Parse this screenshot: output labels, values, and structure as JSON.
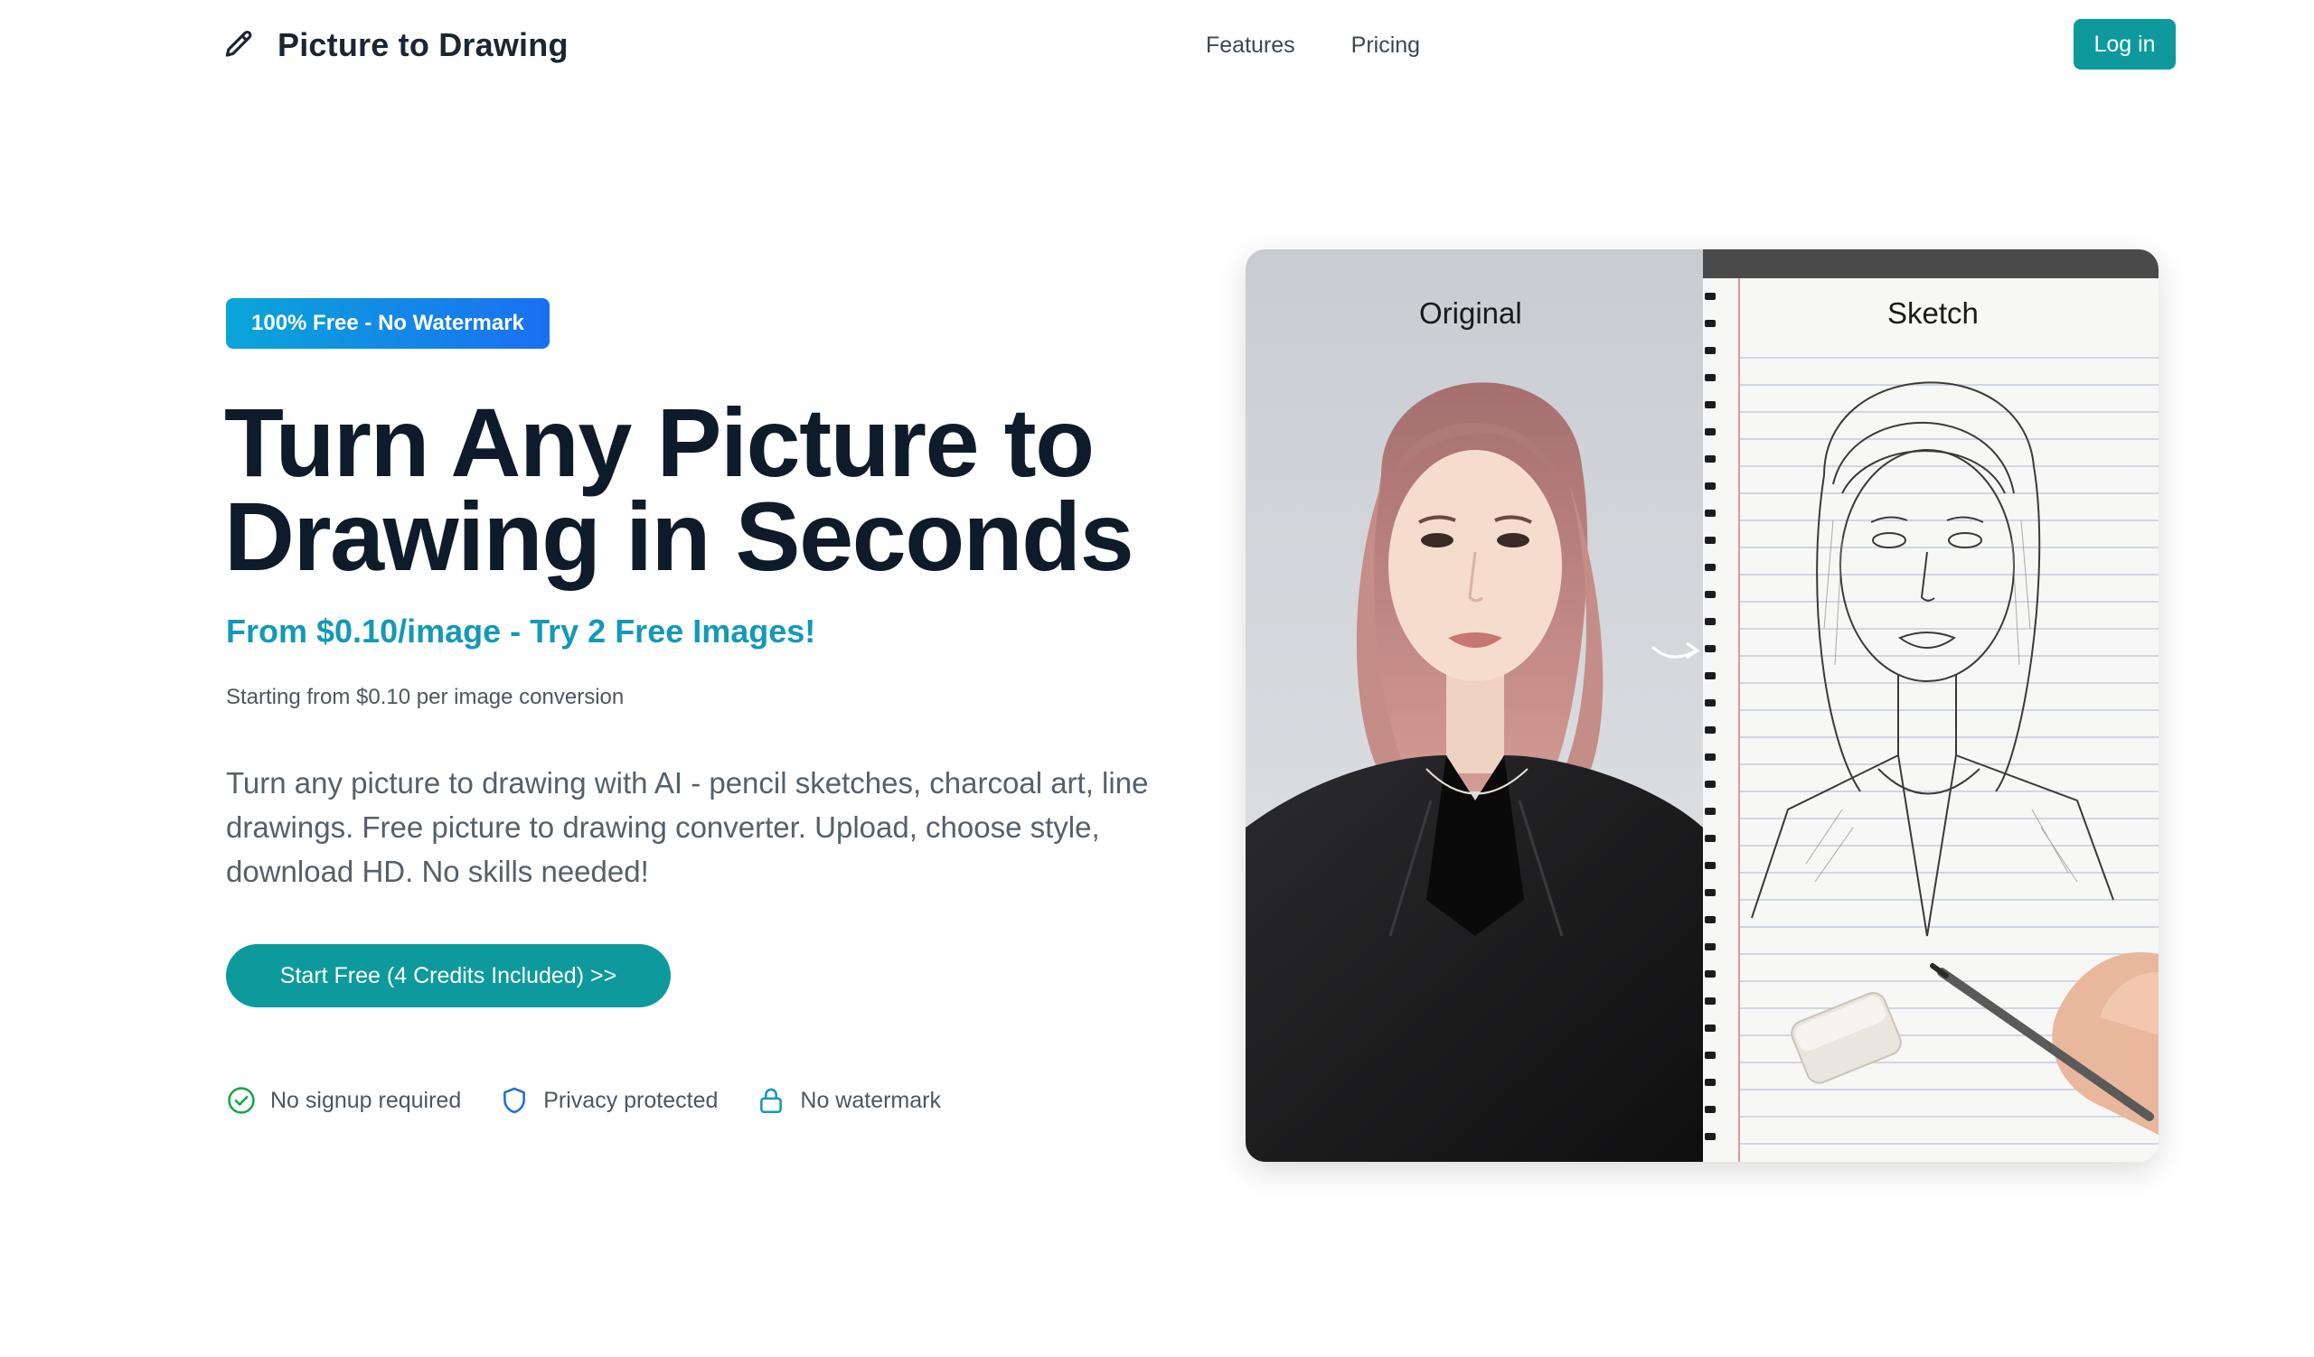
{
  "header": {
    "brand_name": "Picture to Drawing",
    "brand_icon": "pencil-icon",
    "nav": [
      {
        "label": "Features"
      },
      {
        "label": "Pricing"
      }
    ],
    "login_label": "Log in"
  },
  "hero": {
    "badge": "100% Free - No Watermark",
    "title_line1": "Turn Any Picture to",
    "title_line2": "Drawing in Seconds",
    "subtitle": "From $0.10/image - Try 2 Free Images!",
    "note": "Starting from $0.10 per image conversion",
    "description": "Turn any picture to drawing with AI - pencil sketches, charcoal art, line drawings. Free picture to drawing converter. Upload, choose style, download HD. No skills needed!",
    "cta_label": "Start Free (4 Credits Included) >>",
    "features": [
      {
        "icon": "check-circle-icon",
        "label": "No signup required"
      },
      {
        "icon": "shield-icon",
        "label": "Privacy protected"
      },
      {
        "icon": "lock-icon",
        "label": "No watermark"
      }
    ]
  },
  "preview": {
    "original_label": "Original",
    "sketch_label": "Sketch"
  },
  "colors": {
    "accent": "#0e9a9d",
    "subtitle": "#1499b6",
    "badge_start": "#0aa6d8",
    "badge_end": "#1b6ff2",
    "title": "#0d1b2a",
    "feature_check": "#1aa34a",
    "feature_shield": "#1f6fd1",
    "feature_lock": "#1499b6"
  }
}
